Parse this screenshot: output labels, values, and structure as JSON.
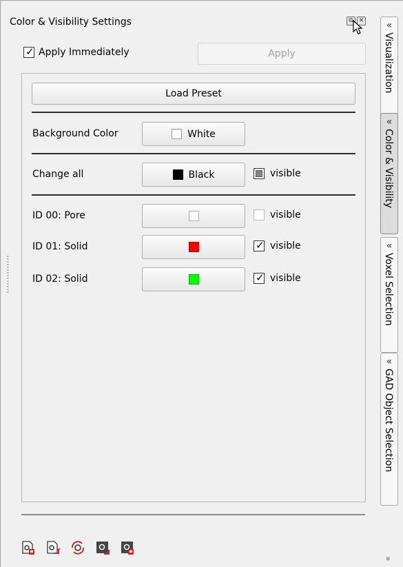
{
  "panel": {
    "title": "Color & Visibility Settings",
    "apply_immediately_label": "Apply Immediately",
    "apply_immediately_checked": true,
    "apply_label": "Apply",
    "load_preset_label": "Load Preset",
    "background": {
      "label": "Background Color",
      "button_label": "White",
      "color": "#ffffff"
    },
    "change_all": {
      "label": "Change all",
      "button_label": "Black",
      "color": "#000000",
      "visible_label": "visible",
      "visible_state": "partial"
    },
    "ids": [
      {
        "label": "ID 00: Pore",
        "color": "#ffffff",
        "visible_label": "visible",
        "visible": false
      },
      {
        "label": "ID 01: Solid",
        "color": "#ff0000",
        "visible_label": "visible",
        "visible": true
      },
      {
        "label": "ID 02: Solid",
        "color": "#00ff00",
        "visible_label": "visible",
        "visible": true
      }
    ]
  },
  "toolbar": {
    "icons": [
      "save-settings-icon",
      "export-settings-icon",
      "reload-settings-icon",
      "import-settings-icon",
      "delete-settings-icon"
    ]
  },
  "tabs": [
    {
      "label": "Visualization",
      "chevron": "«",
      "active": false
    },
    {
      "label": "Color & Visibility",
      "chevron": "«",
      "active": true
    },
    {
      "label": "Voxel Selection",
      "chevron": "«",
      "active": false
    },
    {
      "label": "GAD Object Selection",
      "chevron": "«",
      "active": false
    }
  ],
  "strip_chevron": "»"
}
